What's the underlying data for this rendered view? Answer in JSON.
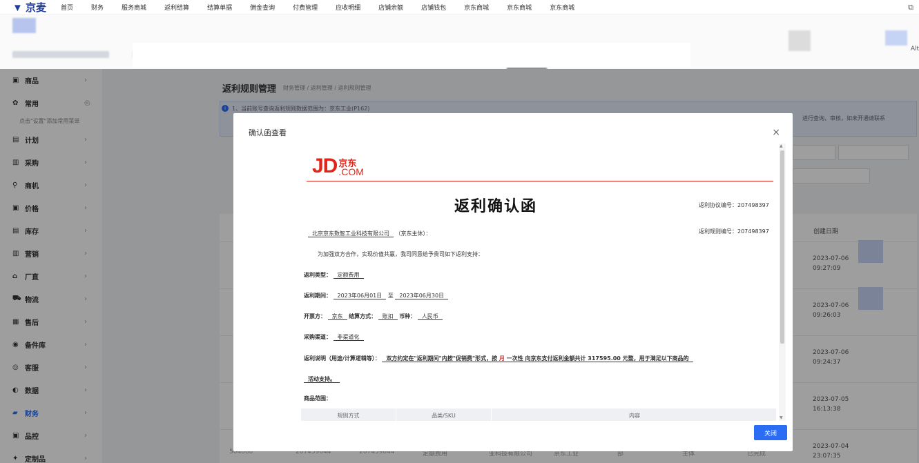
{
  "topnav": {
    "logo": "▼ 京麦",
    "items": [
      "首页",
      "财务",
      "服务商城",
      "返利结算",
      "结算单据",
      "佣金查询",
      "付费管理",
      "应收明细",
      "店铺余额",
      "店铺钱包",
      "京东商城",
      "京东商城",
      "京东商城"
    ],
    "ext_icon": "external-link-icon"
  },
  "header": {
    "alt_label": "Alt"
  },
  "sidebar": {
    "items": [
      {
        "label": "商品",
        "icon": "box-icon"
      },
      {
        "label": "常用",
        "icon": "star-icon",
        "hint": "点击\"设置\"添加常用菜单"
      },
      {
        "label": "计划",
        "icon": "plan-icon"
      },
      {
        "label": "采购",
        "icon": "cart-icon"
      },
      {
        "label": "商机",
        "icon": "location-icon"
      },
      {
        "label": "价格",
        "icon": "price-icon"
      },
      {
        "label": "库存",
        "icon": "inventory-icon"
      },
      {
        "label": "营销",
        "icon": "marketing-icon"
      },
      {
        "label": "厂直",
        "icon": "factory-icon"
      },
      {
        "label": "物流",
        "icon": "truck-icon"
      },
      {
        "label": "售后",
        "icon": "service-icon"
      },
      {
        "label": "备件库",
        "icon": "parts-icon"
      },
      {
        "label": "客服",
        "icon": "headset-icon"
      },
      {
        "label": "数据",
        "icon": "chart-icon"
      },
      {
        "label": "财务",
        "icon": "wallet-icon",
        "active": true
      },
      {
        "label": "品控",
        "icon": "quality-icon"
      },
      {
        "label": "定制品",
        "icon": "custom-icon"
      }
    ]
  },
  "page": {
    "title": "返利规则管理",
    "breadcrumb": "财务管理 / 返利管理 / 返利规则管理",
    "info": "1、当前账号查询返利规则数据范围为：京东工业(P162)",
    "info_right": "进行查询、审核，如未开通请联系",
    "date_header": "创建日期",
    "dates": [
      {
        "d": "2023-07-06",
        "t": "09:27:09"
      },
      {
        "d": "2023-07-06",
        "t": "09:26:03"
      },
      {
        "d": "2023-07-06",
        "t": "09:24:37"
      },
      {
        "d": "2023-07-05",
        "t": "16:13:38"
      },
      {
        "d": "2023-07-04",
        "t": "23:07:35"
      }
    ],
    "bottom_row": [
      "504660",
      "207459044",
      "207459044",
      "定额费用",
      "业科技有限公司",
      "京东工业",
      "部",
      "主体",
      "已完成"
    ]
  },
  "modal": {
    "title": "确认函查看",
    "close_icon": "×",
    "close_button": "关闭",
    "letter": {
      "logo_big": "JD",
      "logo_cn": "京东",
      "logo_com": ".COM",
      "title": "返利确认函",
      "agreement_no": "返利协议编号：207498397",
      "rule_no": "返利规则编号：207498397",
      "company": "北京京东数智工业科技有限公司",
      "company_suffix": "（京东主体）：",
      "intro": "为加强双方合作，实现价值共赢，我司同意给予贵司如下返利支持：",
      "type_label": "返利类型：",
      "type_value": "定额费用",
      "period_label": "返利期间：",
      "period_start": "2023年06月01日",
      "period_to": "至",
      "period_end": "2023年06月30日",
      "issuer_label": "开票方：",
      "issuer_value": "京东",
      "settle_label": "结算方式：",
      "settle_value": "账扣",
      "currency_label": "币种：",
      "currency_value": "人民币",
      "channel_label": "采购渠道：",
      "channel_value": "非渠道化",
      "desc_label": "返利说明（用途/计算逻辑等）：",
      "desc_1": "双方约定在\"返利期间\"内按\"促销费\"形式，按",
      "desc_month": "月",
      "desc_2": "一次性 向京东支付返利金额共计 317595.00 元整，用于满足以下商品的",
      "desc_3": "活动支持。",
      "scope_label": "商品范围：",
      "table_headers": [
        "规则方式",
        "品类/SKU",
        "内容"
      ]
    }
  }
}
